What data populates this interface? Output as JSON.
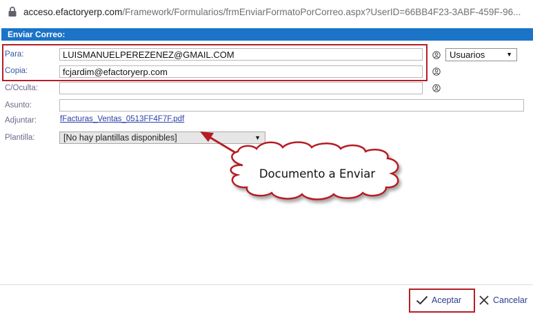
{
  "browser": {
    "url_domain": "acceso.efactoryerp.com",
    "url_path": "/Framework/Formularios/frmEnviarFormatoPorCorreo.aspx?UserID=66BB4F23-3ABF-459F-96..."
  },
  "dialog": {
    "title": "Enviar Correo:"
  },
  "form": {
    "para_label": "Para:",
    "para_value": "LUISMANUELPEREZENEZ@GMAIL.COM",
    "copia_label": "Copia:",
    "copia_value": "fcjardim@efactoryerp.com",
    "coculta_label": "C/Oculta:",
    "coculta_value": "",
    "asunto_label": "Asunto:",
    "asunto_value": "",
    "adjuntar_label": "Adjuntar:",
    "adjuntar_file": "fFacturas_Ventas_0513FF4F7F.pdf",
    "plantilla_label": "Plantilla:",
    "plantilla_selected": "[No hay plantillas disponibles]",
    "usuarios_selected": "Usuarios"
  },
  "annotation": {
    "callout_text": "Documento a Enviar",
    "highlight_color": "#b51d24"
  },
  "footer": {
    "accept_label": "Aceptar",
    "cancel_label": "Cancelar"
  },
  "colors": {
    "header_bg": "#1b74c8",
    "link": "#2a3fa8"
  },
  "icons": [
    "lock-icon",
    "person-icon",
    "chevron-down-icon",
    "checkmark-icon",
    "close-icon"
  ]
}
